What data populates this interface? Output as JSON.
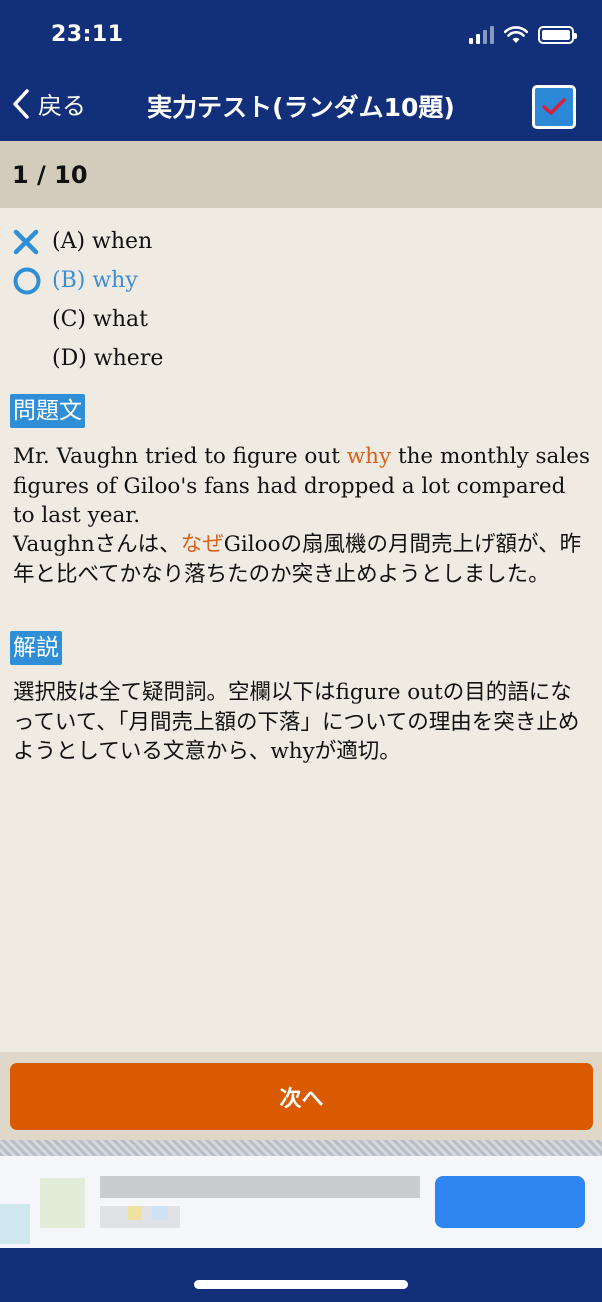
{
  "status": {
    "time": "23:11"
  },
  "nav": {
    "back_label": "戻る",
    "title": "実力テスト(ランダム10題)"
  },
  "progress": {
    "text": "1 / 10"
  },
  "choices": [
    {
      "label": "(A) when",
      "state": "wrong"
    },
    {
      "label": "(B) why",
      "state": "correct"
    },
    {
      "label": "(C) what",
      "state": "none"
    },
    {
      "label": "(D) where",
      "state": "none"
    }
  ],
  "question": {
    "tag": "問題文",
    "en_before": "Mr. Vaughn tried to figure out ",
    "en_highlight": "why",
    "en_after": " the monthly sales figures of Giloo's fans had dropped a lot compared to last year.",
    "ja_before": "Vaughnさんは、",
    "ja_highlight": "なぜ",
    "ja_after": "Gilooの扇風機の月間売上げ額が、昨年と比べてかなり落ちたのか突き止めようとしました。"
  },
  "explanation": {
    "tag": "解説",
    "text": "選択肢は全て疑問詞。空欄以下はfigure outの目的語になっていて、「月間売上額の下落」についての理由を突き止めようとしている文意から、whyが適切。"
  },
  "next_button": {
    "label": "次へ"
  },
  "colors": {
    "nav_bg": "#12307a",
    "accent_blue": "#2f8ed6",
    "highlight_orange": "#d9611c",
    "next_button": "#d95a00"
  }
}
